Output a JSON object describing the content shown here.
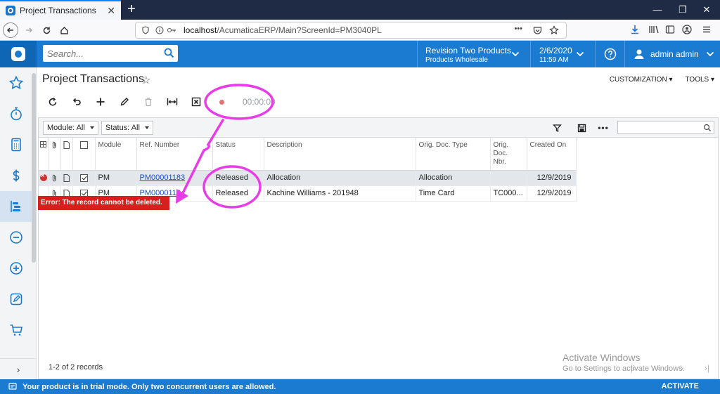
{
  "browser": {
    "tab_title": "Project Transactions",
    "new_tab_label": "+",
    "url_host": "localhost",
    "url_path": "/AcumaticaERP/Main?ScreenId=PM3040PL",
    "url_more": "•••"
  },
  "header": {
    "search_placeholder": "Search...",
    "branch_name": "Revision Two Products",
    "branch_sub": "Products Wholesale",
    "date": "2/6/2020",
    "time": "11:59 AM",
    "user_name": "admin admin"
  },
  "page": {
    "title": "Project Transactions",
    "links": [
      "CUSTOMIZATION ▾",
      "TOOLS ▾"
    ],
    "timer": "00:00:00"
  },
  "filters": {
    "module": "Module: All",
    "status": "Status: All"
  },
  "table": {
    "columns": [
      "Module",
      "Ref. Number",
      "Status",
      "Description",
      "Orig. Doc. Type",
      "Orig. Doc. Nbr.",
      "Created On"
    ],
    "rows": [
      {
        "module": "PM",
        "ref": "PM00001183",
        "status": "Released",
        "description": "Allocation",
        "orig_type": "Allocation",
        "orig_nbr": "",
        "created": "12/9/2019"
      },
      {
        "module": "PM",
        "ref": "PM00001184",
        "status": "Released",
        "description": "Kachine Williams - 201948",
        "orig_type": "Time Card",
        "orig_nbr": "TC000...",
        "created": "12/9/2019"
      }
    ]
  },
  "error_message": "Error: The record cannot be deleted.",
  "footer": {
    "record_count": "1-2 of 2 records"
  },
  "watermark": {
    "title": "Activate Windows",
    "subtitle": "Go to Settings to activate Windows."
  },
  "trial": {
    "message": "Your product is in trial mode. Only two concurrent users are allowed.",
    "activate": "ACTIVATE"
  },
  "colors": {
    "brand_blue": "#1a7bd1",
    "annotation_magenta": "#e83ce8",
    "error_red": "#d91e1e"
  }
}
